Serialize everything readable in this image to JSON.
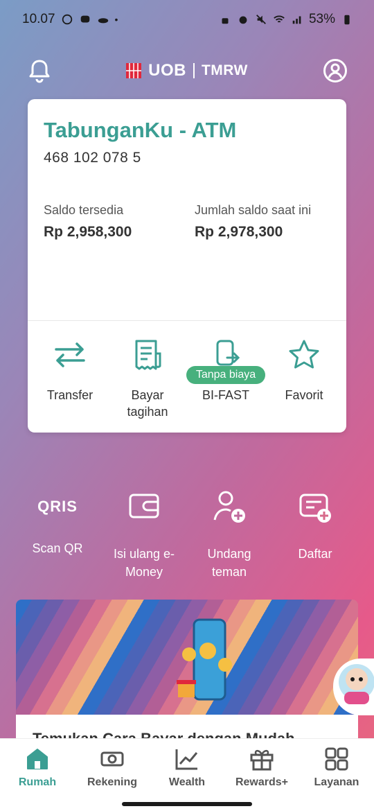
{
  "status_bar": {
    "time": "10.07",
    "battery": "53%"
  },
  "header": {
    "brand": "UOB",
    "product": "TMRW"
  },
  "account": {
    "name": "TabunganKu - ATM",
    "number": "468 102 078 5",
    "available_label": "Saldo tersedia",
    "available_value": "Rp 2,958,300",
    "current_label": "Jumlah saldo saat ini",
    "current_value": "Rp 2,978,300"
  },
  "actions": [
    {
      "label": "Transfer",
      "icon": "transfer-arrows-icon"
    },
    {
      "label": "Bayar tagihan",
      "icon": "receipt-icon"
    },
    {
      "label": "BI-FAST",
      "icon": "phone-arrow-icon",
      "badge": "Tanpa biaya"
    },
    {
      "label": "Favorit",
      "icon": "star-icon"
    }
  ],
  "quick_actions": [
    {
      "label": "Scan QR",
      "icon": "qris-icon",
      "icon_text": "QRIS"
    },
    {
      "label": "Isi ulang e-Money",
      "icon": "wallet-icon"
    },
    {
      "label": "Undang teman",
      "icon": "add-user-icon"
    },
    {
      "label": "Daftar",
      "icon": "card-add-icon"
    }
  ],
  "promo": {
    "title": "Temukan Cara Bayar dengan Mudah"
  },
  "bottom_nav": [
    {
      "label": "Rumah",
      "icon": "home-icon",
      "active": true
    },
    {
      "label": "Rekening",
      "icon": "cash-icon"
    },
    {
      "label": "Wealth",
      "icon": "chart-line-icon"
    },
    {
      "label": "Rewards+",
      "icon": "gift-icon"
    },
    {
      "label": "Layanan",
      "icon": "grid-icon"
    }
  ],
  "colors": {
    "accent": "#3b9e93",
    "badge": "#47b07d",
    "brand_red": "#e0283c"
  }
}
